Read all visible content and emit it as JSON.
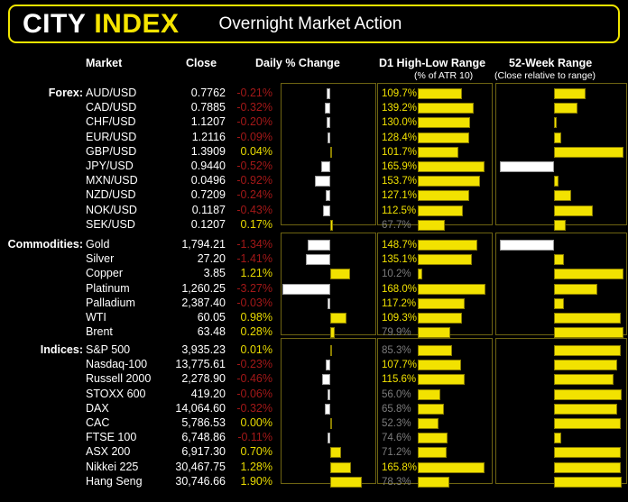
{
  "header": {
    "brand_first": "CITY",
    "brand_second": "INDEX",
    "title": "Overnight Market Action"
  },
  "columns": {
    "market": "Market",
    "close": "Close",
    "daily_change": "Daily % Change",
    "d1_range": "D1 High-Low Range",
    "d1_range_sub": "(% of ATR 10)",
    "week52": "52-Week Range",
    "week52_sub": "(Close relative to range)"
  },
  "colors": {
    "accent": "#f2e200",
    "negative": "#a31818",
    "positive": "#e9db00",
    "muted": "#7c7c7c",
    "panel_border": "#6e6412",
    "background": "#000000"
  },
  "sections": [
    {
      "label": "Forex:",
      "rows": [
        {
          "market": "AUD/USD",
          "close": "0.7762",
          "change": "-0.21%",
          "change_value": -0.21,
          "atr": "109.7%",
          "atr_value": 109.7,
          "week52_value": 0.72
        },
        {
          "market": "CAD/USD",
          "close": "0.7885",
          "change": "-0.32%",
          "change_value": -0.32,
          "atr": "139.2%",
          "atr_value": 139.2,
          "week52_value": 0.66
        },
        {
          "market": "CHF/USD",
          "close": "1.1207",
          "change": "-0.20%",
          "change_value": -0.2,
          "atr": "130.0%",
          "atr_value": 130.0,
          "week52_value": 0.52
        },
        {
          "market": "EUR/USD",
          "close": "1.2116",
          "change": "-0.09%",
          "change_value": -0.09,
          "atr": "128.4%",
          "atr_value": 128.4,
          "week52_value": 0.55
        },
        {
          "market": "GBP/USD",
          "close": "1.3909",
          "change": "0.04%",
          "change_value": 0.04,
          "atr": "101.7%",
          "atr_value": 101.7,
          "week52_value": 0.98
        },
        {
          "market": "JPY/USD",
          "close": "0.9440",
          "change": "-0.52%",
          "change_value": -0.52,
          "atr": "165.9%",
          "atr_value": 165.9,
          "week52_value": 0.02
        },
        {
          "market": "MXN/USD",
          "close": "0.0496",
          "change": "-0.92%",
          "change_value": -0.92,
          "atr": "153.7%",
          "atr_value": 153.7,
          "week52_value": 0.53
        },
        {
          "market": "NZD/USD",
          "close": "0.7209",
          "change": "-0.24%",
          "change_value": -0.24,
          "atr": "127.1%",
          "atr_value": 127.1,
          "week52_value": 0.62
        },
        {
          "market": "NOK/USD",
          "close": "0.1187",
          "change": "-0.43%",
          "change_value": -0.43,
          "atr": "112.5%",
          "atr_value": 112.5,
          "week52_value": 0.77
        },
        {
          "market": "SEK/USD",
          "close": "0.1207",
          "change": "0.17%",
          "change_value": 0.17,
          "atr": "67.7%",
          "atr_value": 67.7,
          "week52_value": 0.58
        }
      ]
    },
    {
      "label": "Commodities:",
      "rows": [
        {
          "market": "Gold",
          "close": "1,794.21",
          "change": "-1.34%",
          "change_value": -1.34,
          "atr": "148.7%",
          "atr_value": 148.7,
          "week52_value": 0.02
        },
        {
          "market": "Silver",
          "close": "27.20",
          "change": "-1.41%",
          "change_value": -1.41,
          "atr": "135.1%",
          "atr_value": 135.1,
          "week52_value": 0.57
        },
        {
          "market": "Copper",
          "close": "3.85",
          "change": "1.21%",
          "change_value": 1.21,
          "atr": "10.2%",
          "atr_value": 10.2,
          "week52_value": 0.98
        },
        {
          "market": "Platinum",
          "close": "1,260.25",
          "change": "-3.27%",
          "change_value": -3.27,
          "atr": "168.0%",
          "atr_value": 168.0,
          "week52_value": 0.8
        },
        {
          "market": "Palladium",
          "close": "2,387.40",
          "change": "-0.03%",
          "change_value": -0.03,
          "atr": "117.2%",
          "atr_value": 117.2,
          "week52_value": 0.57
        },
        {
          "market": "WTI",
          "close": "60.05",
          "change": "0.98%",
          "change_value": 0.98,
          "atr": "109.3%",
          "atr_value": 109.3,
          "week52_value": 0.96
        },
        {
          "market": "Brent",
          "close": "63.48",
          "change": "0.28%",
          "change_value": 0.28,
          "atr": "79.9%",
          "atr_value": 79.9,
          "week52_value": 0.98
        }
      ]
    },
    {
      "label": "Indices:",
      "rows": [
        {
          "market": "S&P 500",
          "close": "3,935.23",
          "change": "0.01%",
          "change_value": 0.01,
          "atr": "85.3%",
          "atr_value": 85.3,
          "week52_value": 0.96
        },
        {
          "market": "Nasdaq-100",
          "close": "13,775.61",
          "change": "-0.23%",
          "change_value": -0.23,
          "atr": "107.7%",
          "atr_value": 107.7,
          "week52_value": 0.94
        },
        {
          "market": "Russell 2000",
          "close": "2,278.90",
          "change": "-0.46%",
          "change_value": -0.46,
          "atr": "115.6%",
          "atr_value": 115.6,
          "week52_value": 0.91
        },
        {
          "market": "STOXX 600",
          "close": "419.20",
          "change": "-0.06%",
          "change_value": -0.06,
          "atr": "56.0%",
          "atr_value": 56.0,
          "week52_value": 0.97
        },
        {
          "market": "DAX",
          "close": "14,064.60",
          "change": "-0.32%",
          "change_value": -0.32,
          "atr": "65.8%",
          "atr_value": 65.8,
          "week52_value": 0.94
        },
        {
          "market": "CAC",
          "close": "5,786.53",
          "change": "0.00%",
          "change_value": 0.0,
          "atr": "52.3%",
          "atr_value": 52.3,
          "week52_value": 0.96
        },
        {
          "market": "FTSE 100",
          "close": "6,748.86",
          "change": "-0.11%",
          "change_value": -0.11,
          "atr": "74.6%",
          "atr_value": 74.6,
          "week52_value": 0.55
        },
        {
          "market": "ASX 200",
          "close": "6,917.30",
          "change": "0.70%",
          "change_value": 0.7,
          "atr": "71.2%",
          "atr_value": 71.2,
          "week52_value": 0.96
        },
        {
          "market": "Nikkei 225",
          "close": "30,467.75",
          "change": "1.28%",
          "change_value": 1.28,
          "atr": "165.8%",
          "atr_value": 165.8,
          "week52_value": 0.96
        },
        {
          "market": "Hang Seng",
          "close": "30,746.66",
          "change": "1.90%",
          "change_value": 1.9,
          "atr": "78.3%",
          "atr_value": 78.3,
          "week52_value": 0.97
        }
      ]
    }
  ],
  "chart_data": {
    "type": "bar",
    "title": "Overnight Market Action",
    "panels": [
      {
        "name": "Daily % Change",
        "type": "diverging-bar",
        "unit": "%",
        "baseline": 0,
        "xlim": [
          -3.6,
          2.4
        ]
      },
      {
        "name": "D1 High-Low Range",
        "subtitle": "(% of ATR 10)",
        "type": "bar",
        "unit": "%",
        "xlim": [
          0,
          175
        ],
        "highlight_threshold": 100
      },
      {
        "name": "52-Week Range",
        "subtitle": "(Close relative to range)",
        "type": "diverging-bar",
        "unit": "fraction",
        "baseline": 0.5,
        "xlim": [
          0,
          1
        ]
      }
    ],
    "categories": [
      "AUD/USD",
      "CAD/USD",
      "CHF/USD",
      "EUR/USD",
      "GBP/USD",
      "JPY/USD",
      "MXN/USD",
      "NZD/USD",
      "NOK/USD",
      "SEK/USD",
      "Gold",
      "Silver",
      "Copper",
      "Platinum",
      "Palladium",
      "WTI",
      "Brent",
      "S&P 500",
      "Nasdaq-100",
      "Russell 2000",
      "STOXX 600",
      "DAX",
      "CAC",
      "FTSE 100",
      "ASX 200",
      "Nikkei 225",
      "Hang Seng"
    ],
    "series": [
      {
        "name": "Daily % Change",
        "values": [
          -0.21,
          -0.32,
          -0.2,
          -0.09,
          0.04,
          -0.52,
          -0.92,
          -0.24,
          -0.43,
          0.17,
          -1.34,
          -1.41,
          1.21,
          -3.27,
          -0.03,
          0.98,
          0.28,
          0.01,
          -0.23,
          -0.46,
          -0.06,
          -0.32,
          0.0,
          -0.11,
          0.7,
          1.28,
          1.9
        ]
      },
      {
        "name": "D1 High-Low Range (% of ATR 10)",
        "values": [
          109.7,
          139.2,
          130.0,
          128.4,
          101.7,
          165.9,
          153.7,
          127.1,
          112.5,
          67.7,
          148.7,
          135.1,
          10.2,
          168.0,
          117.2,
          109.3,
          79.9,
          85.3,
          107.7,
          115.6,
          56.0,
          65.8,
          52.3,
          74.6,
          71.2,
          165.8,
          78.3
        ]
      },
      {
        "name": "52-Week Range (Close relative to range)",
        "values": [
          0.72,
          0.66,
          0.52,
          0.55,
          0.98,
          0.02,
          0.53,
          0.62,
          0.77,
          0.58,
          0.02,
          0.57,
          0.98,
          0.8,
          0.57,
          0.96,
          0.98,
          0.96,
          0.94,
          0.91,
          0.97,
          0.94,
          0.96,
          0.55,
          0.96,
          0.96,
          0.97
        ]
      }
    ]
  }
}
